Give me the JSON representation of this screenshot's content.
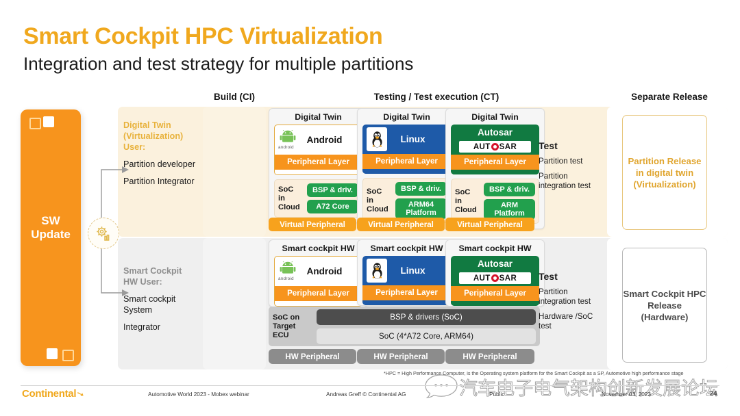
{
  "title": "Smart Cockpit HPC Virtualization",
  "subtitle": "Integration and test strategy for multiple partitions",
  "columns": {
    "build": "Build (CI)",
    "testing": "Testing / Test execution (CT)",
    "release": "Separate Release"
  },
  "sw_update": {
    "label": "SW\nUpdate",
    "line1": "SW",
    "line2": "Update"
  },
  "users": {
    "top": {
      "heading_line1": "Digital Twin",
      "heading_line2": "(Virtualization)",
      "heading_line3": "User:",
      "items": [
        "Partition developer",
        "Partition Integrator"
      ]
    },
    "bottom": {
      "heading_line1": "Smart Cockpit",
      "heading_line2": "HW User:",
      "items": [
        "Smart cockpit System",
        "Integrator"
      ]
    }
  },
  "rows": [
    {
      "id": "digital-twin",
      "card_title": "Digital Twin",
      "peripheral_bar": "Virtual Peripheral",
      "cards": [
        {
          "os": "Android",
          "os_icon": "android-robot-icon",
          "wordmark": "android",
          "peripheral": "Peripheral Layer",
          "soc_label": "SoC in Cloud",
          "soc_label_lines": [
            "SoC",
            "in",
            "Cloud"
          ],
          "chips": [
            "BSP & driv.",
            "A72 Core"
          ]
        },
        {
          "os": "Linux",
          "os_icon": "tux-penguin-icon",
          "peripheral": "Peripheral Layer",
          "soc_label_lines": [
            "SoC",
            "in",
            "Cloud"
          ],
          "chips": [
            "BSP & driv.",
            "ARM64 Platform"
          ]
        },
        {
          "os": "Autosar",
          "os_icon": "autosar-logo-icon",
          "wordmark": "AUT SAR",
          "wordmark_left": "AUT",
          "wordmark_right": "SAR",
          "peripheral": "Peripheral Layer",
          "soc_label_lines": [
            "SoC",
            "in",
            "Cloud"
          ],
          "chips": [
            "BSP & driv.",
            "ARM Platform"
          ]
        }
      ],
      "test": {
        "heading": "Test",
        "items": [
          "Partition test",
          "Partition integration test"
        ]
      },
      "release": "Partition Release in digital twin (Virtualization)"
    },
    {
      "id": "smart-cockpit-hw",
      "card_title": "Smart cockpit HW",
      "peripheral_bar": "HW Peripheral",
      "cards": [
        {
          "os": "Android",
          "os_icon": "android-robot-icon",
          "wordmark": "android",
          "peripheral": "Peripheral Layer"
        },
        {
          "os": "Linux",
          "os_icon": "tux-penguin-icon",
          "peripheral": "Peripheral Layer"
        },
        {
          "os": "Autosar",
          "os_icon": "autosar-logo-icon",
          "peripheral": "Peripheral Layer"
        }
      ],
      "soc_target": {
        "label_lines": [
          "SoC on",
          "Target ECU"
        ],
        "bars": [
          "BSP & drivers (SoC)",
          "SoC (4*A72 Core, ARM64)"
        ]
      },
      "test": {
        "heading": "Test",
        "items": [
          "Partition integration test",
          "Hardware /SoC test"
        ]
      },
      "release": "Smart Cockpit HPC  Release (Hardware)"
    }
  ],
  "footnote": "*HPC = High Performance Computer, is the Operating system platform for the Smart Cockpit as a SP, Automotive high performance stage",
  "footer": {
    "brand": "Continental",
    "event": "Automotive World 2023 - Mobex webinar",
    "author": "Andreas Greff © Continental AG",
    "classification": "Public",
    "date": "November 03, 2023",
    "page": "24"
  },
  "watermark": {
    "text": "汽车电子电气架构创新发展论坛"
  },
  "colors": {
    "brand_orange": "#f7941d",
    "title_gold": "#f0a81e",
    "green_chip": "#22a04d",
    "linux_blue": "#1e5aa8",
    "autosar_green": "#117a41",
    "grey_bar": "#8c8c8c"
  }
}
